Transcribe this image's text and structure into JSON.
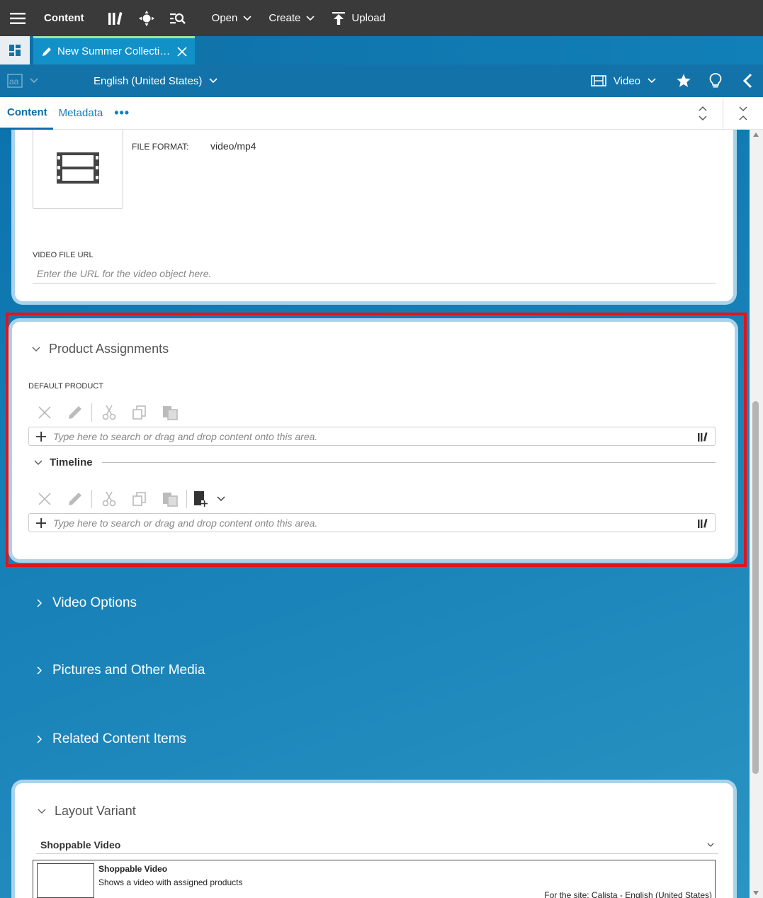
{
  "topbar": {
    "app_title": "Content",
    "open_label": "Open",
    "create_label": "Create",
    "upload_label": "Upload"
  },
  "tab": {
    "label": "New Summer Collection Video"
  },
  "locale_bar": {
    "locale": "English (United States)",
    "content_type": "Video"
  },
  "subtabs": {
    "content": "Content",
    "metadata": "Metadata",
    "more": "•••"
  },
  "video_card": {
    "file_format_label": "FILE FORMAT:",
    "file_format_value": "video/mp4",
    "url_label": "VIDEO FILE URL",
    "url_placeholder": "Enter the URL for the video object here."
  },
  "product_assignments": {
    "title": "Product Assignments",
    "default_product_label": "DEFAULT PRODUCT",
    "default_product_placeholder": "Type here to search or drag and drop content onto this area.",
    "timeline_title": "Timeline",
    "timeline_placeholder": "Type here to search or drag and drop content onto this area."
  },
  "collapsed_sections": [
    "Video Options",
    "Pictures and Other Media",
    "Related Content Items"
  ],
  "layout_variant": {
    "title": "Layout Variant",
    "selected": "Shoppable Video",
    "option_title": "Shoppable Video",
    "option_desc": "Shows a video with assigned products",
    "option_site": "For the site: Calista - English (United States)"
  },
  "colors": {
    "highlight": "#e0141c",
    "accent": "#1380c0",
    "topbar": "#3a3a3a"
  }
}
